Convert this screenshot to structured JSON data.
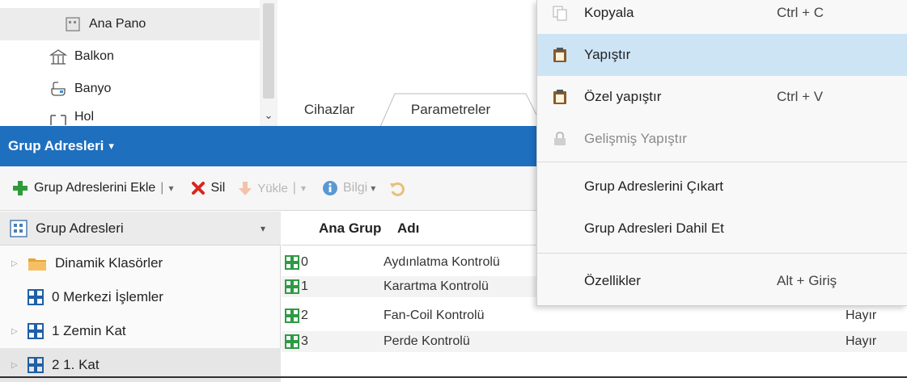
{
  "top_tree": {
    "items": [
      {
        "label": "Ana Pano",
        "icon": "panel-icon"
      },
      {
        "label": "Balkon",
        "icon": "room-icon"
      },
      {
        "label": "Banyo",
        "icon": "bathroom-icon"
      },
      {
        "label": "Hol",
        "icon": "hall-icon"
      }
    ]
  },
  "tabs": [
    {
      "label": "Cihazlar"
    },
    {
      "label": "Parametreler"
    }
  ],
  "panel": {
    "title": "Grup Adresleri",
    "caret": "▾"
  },
  "toolbar": {
    "add_label": "Grup Adreslerini Ekle",
    "delete_label": "Sil",
    "upload_label": "Yükle",
    "info_label": "Bilgi",
    "sep": "|",
    "caret": "▾"
  },
  "tree": {
    "header": "Grup Adresleri",
    "items": [
      {
        "label": "Dinamik Klasörler",
        "icon": "folder-icon",
        "expander": "▷"
      },
      {
        "label": "0 Merkezi İşlemler",
        "icon": "group-address-icon",
        "expander": ""
      },
      {
        "label": "1 Zemin Kat",
        "icon": "group-address-icon",
        "expander": "▷"
      },
      {
        "label": "2 1. Kat",
        "icon": "group-address-icon",
        "expander": "▷"
      }
    ]
  },
  "table": {
    "columns": [
      "Ana Grup",
      "Adı"
    ],
    "rows": [
      {
        "main_group": "0",
        "name": "Aydınlatma Kontrolü",
        "value": ""
      },
      {
        "main_group": "1",
        "name": "Karartma Kontrolü",
        "value": ""
      },
      {
        "main_group": "2",
        "name": "Fan-Coil Kontrolü",
        "value": "Hayır"
      },
      {
        "main_group": "3",
        "name": "Perde Kontrolü",
        "value": "Hayır"
      }
    ]
  },
  "context_menu": {
    "items": [
      {
        "label": "Kopyala",
        "shortcut": "Ctrl + C",
        "icon": "copy-icon"
      },
      {
        "label": "Yapıştır",
        "shortcut": "",
        "icon": "paste-icon"
      },
      {
        "label": "Özel yapıştır",
        "shortcut": "Ctrl + V",
        "icon": "paste-special-icon"
      },
      {
        "label": "Gelişmiş Yapıştır",
        "shortcut": "",
        "icon": "lock-icon"
      },
      {
        "label": "Grup Adreslerini Çıkart",
        "shortcut": "",
        "icon": ""
      },
      {
        "label": "Grup Adresleri Dahil Et",
        "shortcut": "",
        "icon": ""
      },
      {
        "label": "Özellikler",
        "shortcut": "Alt + Giriş",
        "icon": ""
      }
    ]
  },
  "colors": {
    "accent": "#1f6fbf",
    "menu_highlight": "#cde4f5",
    "add_green": "#2e9b3a",
    "delete_red": "#d9261c",
    "group_icon_green": "#2f9a45",
    "group_icon_blue": "#1f5fa8",
    "folder_orange": "#e8a436"
  }
}
